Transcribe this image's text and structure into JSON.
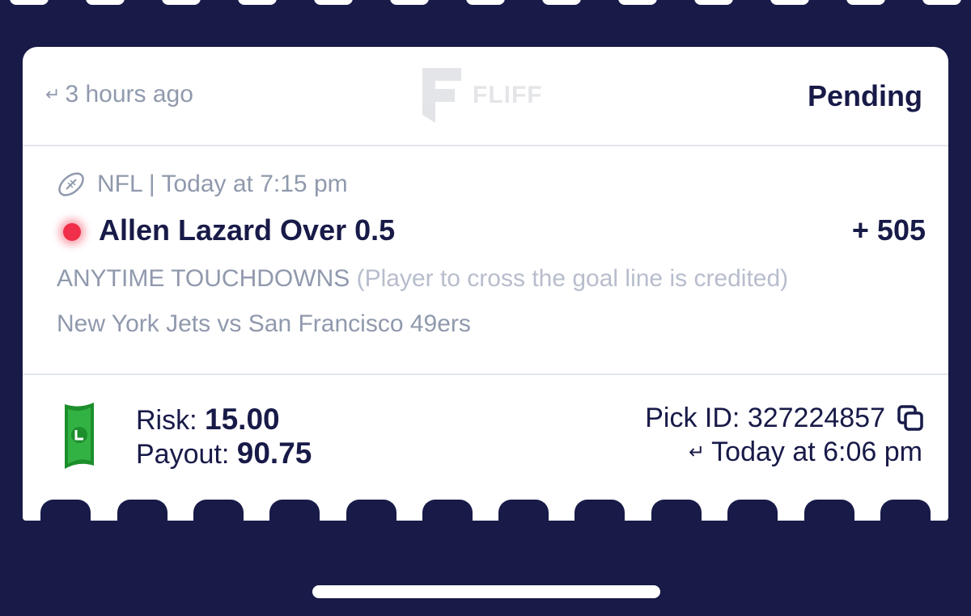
{
  "header": {
    "time_ago": "3 hours ago",
    "brand": "FLIFF",
    "status": "Pending"
  },
  "pick": {
    "league_time": "NFL | Today at 7:15 pm",
    "selection": "Allen Lazard Over 0.5",
    "odds": "+ 505",
    "market": "ANYTIME TOUCHDOWNS",
    "market_note": "(Player to cross the goal line is credited)",
    "matchup": "New York Jets vs San Francisco 49ers"
  },
  "footer": {
    "risk_label": "Risk:",
    "risk_value": "15.00",
    "payout_label": "Payout:",
    "payout_value": "90.75",
    "pick_id_label": "Pick ID:",
    "pick_id": "327224857",
    "placed_time": "Today at 6:06 pm"
  },
  "icons": {
    "time_arrow": "return-arrow-icon",
    "sport": "football-icon",
    "live": "live-dot-icon",
    "currency": "cash-icon",
    "copy": "copy-icon"
  },
  "colors": {
    "background": "#181a48",
    "card": "#ffffff",
    "primary_text": "#181a48",
    "muted_text": "#9099ad",
    "live_dot": "#f0304a",
    "cash_green": "#1c8f2c"
  }
}
